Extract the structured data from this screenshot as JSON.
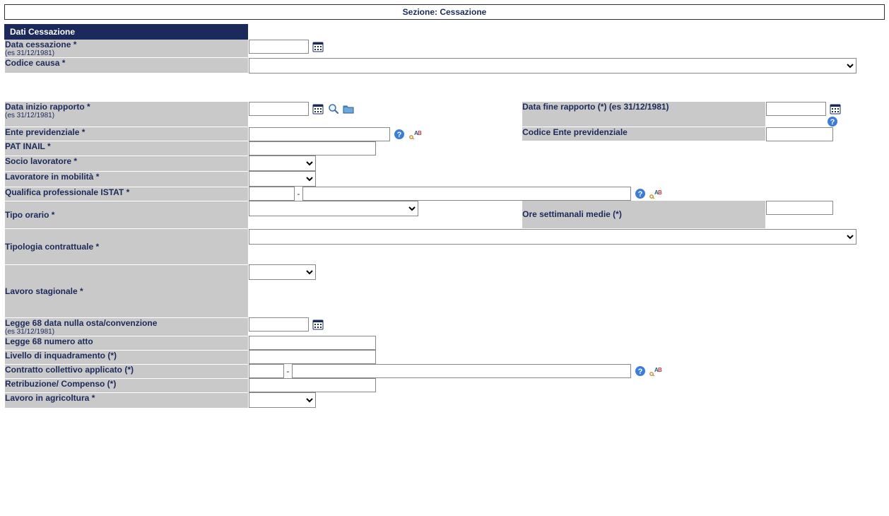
{
  "section_title": "Sezione: Cessazione",
  "subsection_title": "Dati Cessazione",
  "hints": {
    "date_example": "(es 31/12/1981)"
  },
  "fields": {
    "data_cessazione": {
      "label": "Data cessazione *"
    },
    "codice_causa": {
      "label": "Codice causa *",
      "selected": ""
    },
    "data_inizio": {
      "label": "Data inizio rapporto *"
    },
    "data_fine": {
      "label": "Data fine rapporto (*)"
    },
    "ente_prev": {
      "label": "Ente previdenziale *"
    },
    "codice_ente_prev": {
      "label": "Codice Ente previdenziale"
    },
    "pat_inail": {
      "label": "PAT INAIL *"
    },
    "socio_lavoratore": {
      "label": "Socio lavoratore *",
      "selected": ""
    },
    "lavoratore_mob": {
      "label": "Lavoratore in mobilità *",
      "selected": ""
    },
    "qualifica_istat": {
      "label": "Qualifica professionale ISTAT *"
    },
    "tipo_orario": {
      "label": "Tipo orario *",
      "selected": ""
    },
    "ore_settimanali": {
      "label": "Ore settimanali medie (*)"
    },
    "tipologia_contr": {
      "label": "Tipologia contrattuale *",
      "selected": ""
    },
    "lavoro_stagionale": {
      "label": "Lavoro stagionale *",
      "selected": ""
    },
    "legge68_data": {
      "label": "Legge 68 data nulla osta/convenzione"
    },
    "legge68_num": {
      "label": "Legge 68 numero atto"
    },
    "livello_inq": {
      "label": "Livello di inquadramento (*)"
    },
    "ccnl": {
      "label": "Contratto collettivo applicato (*)"
    },
    "retribuzione": {
      "label": "Retribuzione/ Compenso (*)"
    },
    "lavoro_agric": {
      "label": "Lavoro in agricoltura *",
      "selected": ""
    }
  },
  "sep": " - "
}
